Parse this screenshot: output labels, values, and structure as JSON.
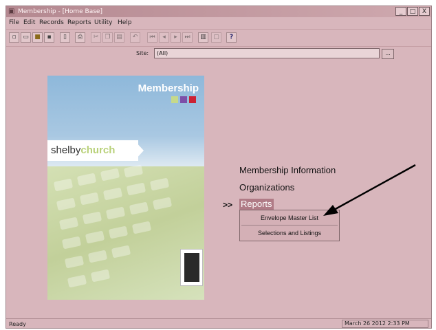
{
  "window": {
    "title": "Membership - [Home Base]",
    "app_icon": "app-icon",
    "controls": {
      "minimize": "_",
      "maximize": "□",
      "close": "X"
    }
  },
  "menubar": [
    "File",
    "Edit",
    "Records",
    "Reports",
    "Utility",
    "Help"
  ],
  "toolbar": {
    "buttons": [
      {
        "icon": "new-icon",
        "enabled": true
      },
      {
        "icon": "open-icon",
        "enabled": true
      },
      {
        "icon": "folder-icon",
        "enabled": true
      },
      {
        "icon": "save-icon",
        "enabled": true
      },
      {
        "icon": "page-icon",
        "enabled": true
      },
      {
        "icon": "print-icon",
        "enabled": true
      },
      {
        "icon": "cut-icon",
        "enabled": false
      },
      {
        "icon": "copy-icon",
        "enabled": false
      },
      {
        "icon": "paste-icon",
        "enabled": false
      },
      {
        "icon": "undo-icon",
        "enabled": false
      },
      {
        "icon": "first-record-icon",
        "enabled": false
      },
      {
        "icon": "prev-record-icon",
        "enabled": false
      },
      {
        "icon": "next-record-icon",
        "enabled": false
      },
      {
        "icon": "last-record-icon",
        "enabled": false
      },
      {
        "icon": "chart-icon",
        "enabled": true
      },
      {
        "icon": "document-icon",
        "enabled": false
      }
    ],
    "help_label": "?"
  },
  "site": {
    "label": "Site:",
    "value": "(All)",
    "browse_label": "..."
  },
  "splash": {
    "heading": "Membership",
    "logo_part1": "shelby",
    "logo_part2": "church",
    "square_colors": [
      "#c6d98a",
      "#7d4fa8",
      "#cc2233"
    ]
  },
  "menu": {
    "items": [
      "Membership Information",
      "Organizations"
    ],
    "marker": ">>",
    "active": "Reports",
    "submenu": [
      "Envelope Master List",
      "Selections and Listings"
    ]
  },
  "status": {
    "text": "Ready",
    "date": "March 26 2012 2:33 PM"
  },
  "colors": {
    "window_bg": "#d8b6bc",
    "highlight": "#b07b86",
    "annotation_arrow": "#000000"
  }
}
